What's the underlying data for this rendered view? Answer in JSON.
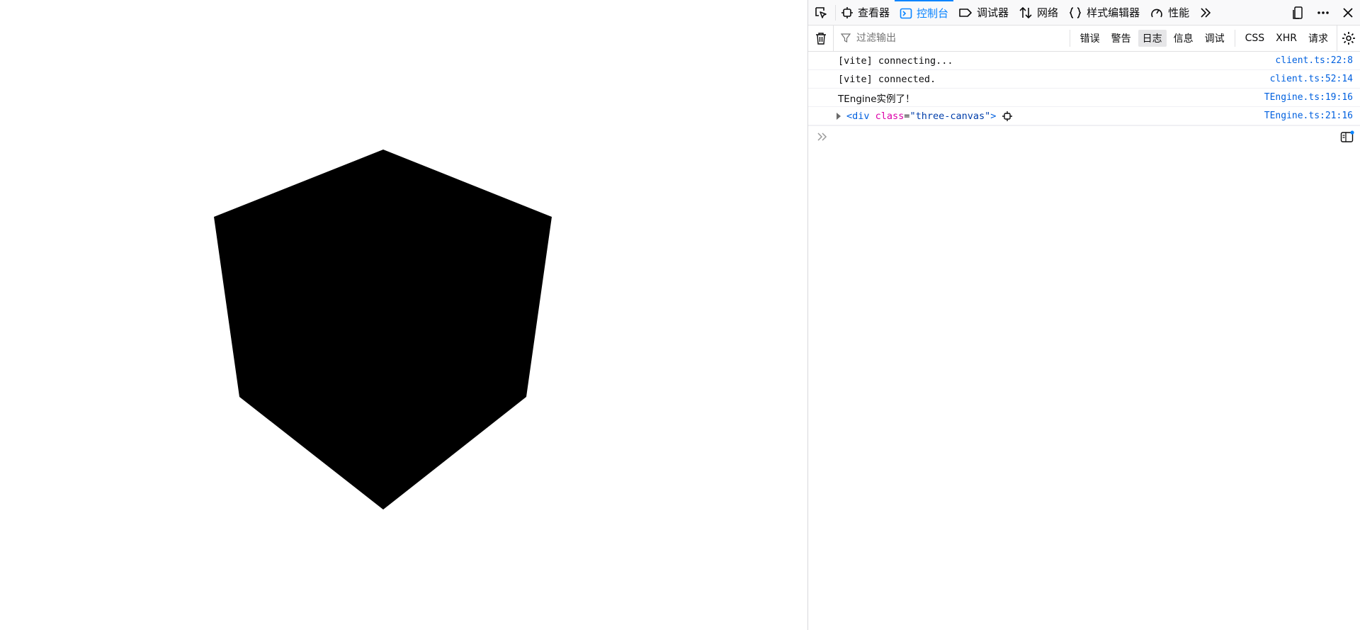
{
  "toolbar": {
    "tabs": [
      {
        "label": "查看器",
        "icon": "inspector-icon"
      },
      {
        "label": "控制台",
        "icon": "console-icon",
        "active": true
      },
      {
        "label": "调试器",
        "icon": "debugger-icon"
      },
      {
        "label": "网络",
        "icon": "network-icon"
      },
      {
        "label": "样式编辑器",
        "icon": "style-editor-icon"
      },
      {
        "label": "性能",
        "icon": "performance-icon"
      }
    ],
    "more_tabs_icon": "double-chevron-right-icon",
    "right_icons": [
      "dock-icon",
      "more-icon",
      "close-icon"
    ]
  },
  "filter": {
    "placeholder": "过滤输出",
    "levels": [
      "错误",
      "警告",
      "日志",
      "信息",
      "调试"
    ],
    "active_level": "日志",
    "requests": [
      "CSS",
      "XHR",
      "请求"
    ]
  },
  "logs": [
    {
      "msg": "[vite] connecting...",
      "src": "client.ts:22:8"
    },
    {
      "msg": "[vite] connected.",
      "src": "client.ts:52:14"
    },
    {
      "msg": "TEngine实例了！",
      "src": "TEngine.ts:19:16"
    }
  ],
  "node_log": {
    "tag_open": "<div",
    "attr": "class",
    "eq": "=",
    "value": "\"three-canvas\"",
    "tag_close": ">",
    "src": "TEngine.ts:21:16"
  },
  "colors": {
    "accent": "#0a84ff",
    "link": "#0060df",
    "cube": "#000000"
  }
}
